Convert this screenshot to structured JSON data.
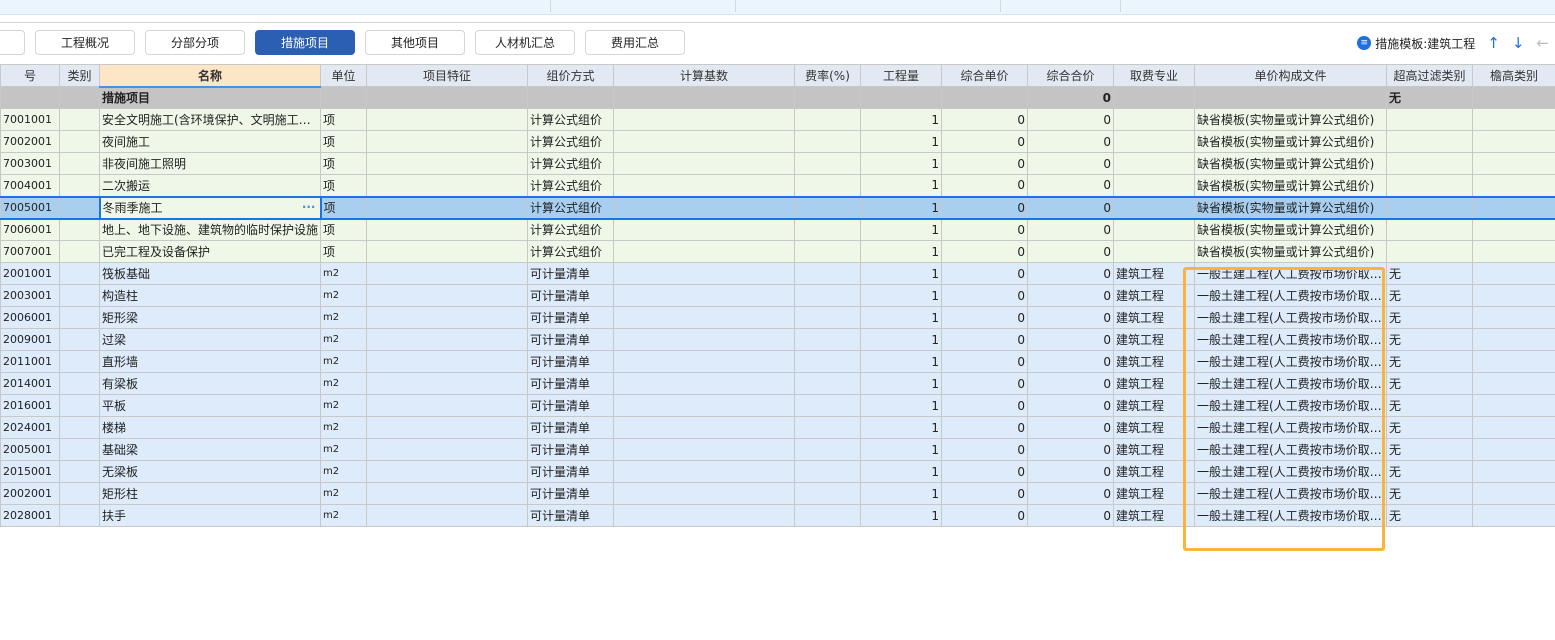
{
  "tabs": [
    {
      "label": ""
    },
    {
      "label": "工程概况"
    },
    {
      "label": "分部分项"
    },
    {
      "label": "措施项目",
      "active": true
    },
    {
      "label": "其他项目"
    },
    {
      "label": "人材机汇总"
    },
    {
      "label": "费用汇总"
    }
  ],
  "template": {
    "icon": "list-icon",
    "label": "措施模板:建筑工程",
    "up": "↑",
    "down": "↓",
    "back": "←"
  },
  "columns": [
    "号",
    "类别",
    "名称",
    "单位",
    "项目特征",
    "组价方式",
    "计算基数",
    "费率(%)",
    "工程量",
    "综合单价",
    "综合合价",
    "取费专业",
    "单价构成文件",
    "超高过滤类别",
    "檐高类别"
  ],
  "section": {
    "name": "措施项目",
    "total": "0",
    "filter": "无"
  },
  "rows": [
    {
      "code": "7001001",
      "name": "安全文明施工(含环境保护、文明施工…",
      "unit": "项",
      "method": "计算公式组价",
      "qty": "1",
      "price": "0",
      "total": "0",
      "spec": "",
      "file": "缺省模板(实物量或计算公式组价)",
      "filter": "",
      "type": "green"
    },
    {
      "code": "7002001",
      "name": "夜间施工",
      "unit": "项",
      "method": "计算公式组价",
      "qty": "1",
      "price": "0",
      "total": "0",
      "spec": "",
      "file": "缺省模板(实物量或计算公式组价)",
      "filter": "",
      "type": "green"
    },
    {
      "code": "7003001",
      "name": "非夜间施工照明",
      "unit": "项",
      "method": "计算公式组价",
      "qty": "1",
      "price": "0",
      "total": "0",
      "spec": "",
      "file": "缺省模板(实物量或计算公式组价)",
      "filter": "",
      "type": "green"
    },
    {
      "code": "7004001",
      "name": "二次搬运",
      "unit": "项",
      "method": "计算公式组价",
      "qty": "1",
      "price": "0",
      "total": "0",
      "spec": "",
      "file": "缺省模板(实物量或计算公式组价)",
      "filter": "",
      "type": "green"
    },
    {
      "code": "7005001",
      "name": "冬雨季施工",
      "unit": "项",
      "method": "计算公式组价",
      "qty": "1",
      "price": "0",
      "total": "0",
      "spec": "",
      "file": "缺省模板(实物量或计算公式组价)",
      "filter": "",
      "type": "sel"
    },
    {
      "code": "7006001",
      "name": "地上、地下设施、建筑物的临时保护设施",
      "unit": "项",
      "method": "计算公式组价",
      "qty": "1",
      "price": "0",
      "total": "0",
      "spec": "",
      "file": "缺省模板(实物量或计算公式组价)",
      "filter": "",
      "type": "green"
    },
    {
      "code": "7007001",
      "name": "已完工程及设备保护",
      "unit": "项",
      "method": "计算公式组价",
      "qty": "1",
      "price": "0",
      "total": "0",
      "spec": "",
      "file": "缺省模板(实物量或计算公式组价)",
      "filter": "",
      "type": "green"
    },
    {
      "code": "2001001",
      "name": "筏板基础",
      "unit": "m2",
      "method": "可计量清单",
      "qty": "1",
      "price": "0",
      "total": "0",
      "spec": "建筑工程",
      "file": "一般土建工程(人工费按市场价取…",
      "filter": "无",
      "type": "blue"
    },
    {
      "code": "2003001",
      "name": "构造柱",
      "unit": "m2",
      "method": "可计量清单",
      "qty": "1",
      "price": "0",
      "total": "0",
      "spec": "建筑工程",
      "file": "一般土建工程(人工费按市场价取…",
      "filter": "无",
      "type": "blue"
    },
    {
      "code": "2006001",
      "name": "矩形梁",
      "unit": "m2",
      "method": "可计量清单",
      "qty": "1",
      "price": "0",
      "total": "0",
      "spec": "建筑工程",
      "file": "一般土建工程(人工费按市场价取…",
      "filter": "无",
      "type": "blue"
    },
    {
      "code": "2009001",
      "name": "过梁",
      "unit": "m2",
      "method": "可计量清单",
      "qty": "1",
      "price": "0",
      "total": "0",
      "spec": "建筑工程",
      "file": "一般土建工程(人工费按市场价取…",
      "filter": "无",
      "type": "blue"
    },
    {
      "code": "2011001",
      "name": "直形墙",
      "unit": "m2",
      "method": "可计量清单",
      "qty": "1",
      "price": "0",
      "total": "0",
      "spec": "建筑工程",
      "file": "一般土建工程(人工费按市场价取…",
      "filter": "无",
      "type": "blue"
    },
    {
      "code": "2014001",
      "name": "有梁板",
      "unit": "m2",
      "method": "可计量清单",
      "qty": "1",
      "price": "0",
      "total": "0",
      "spec": "建筑工程",
      "file": "一般土建工程(人工费按市场价取…",
      "filter": "无",
      "type": "blue"
    },
    {
      "code": "2016001",
      "name": "平板",
      "unit": "m2",
      "method": "可计量清单",
      "qty": "1",
      "price": "0",
      "total": "0",
      "spec": "建筑工程",
      "file": "一般土建工程(人工费按市场价取…",
      "filter": "无",
      "type": "blue"
    },
    {
      "code": "2024001",
      "name": "楼梯",
      "unit": "m2",
      "method": "可计量清单",
      "qty": "1",
      "price": "0",
      "total": "0",
      "spec": "建筑工程",
      "file": "一般土建工程(人工费按市场价取…",
      "filter": "无",
      "type": "blue"
    },
    {
      "code": "2005001",
      "name": "基础梁",
      "unit": "m2",
      "method": "可计量清单",
      "qty": "1",
      "price": "0",
      "total": "0",
      "spec": "建筑工程",
      "file": "一般土建工程(人工费按市场价取…",
      "filter": "无",
      "type": "blue"
    },
    {
      "code": "2015001",
      "name": "无梁板",
      "unit": "m2",
      "method": "可计量清单",
      "qty": "1",
      "price": "0",
      "total": "0",
      "spec": "建筑工程",
      "file": "一般土建工程(人工费按市场价取…",
      "filter": "无",
      "type": "blue"
    },
    {
      "code": "2002001",
      "name": "矩形柱",
      "unit": "m2",
      "method": "可计量清单",
      "qty": "1",
      "price": "0",
      "total": "0",
      "spec": "建筑工程",
      "file": "一般土建工程(人工费按市场价取…",
      "filter": "无",
      "type": "blue"
    },
    {
      "code": "2028001",
      "name": "扶手",
      "unit": "m2",
      "method": "可计量清单",
      "qty": "1",
      "price": "0",
      "total": "0",
      "spec": "建筑工程",
      "file": "一般土建工程(人工费按市场价取…",
      "filter": "无",
      "type": "blue"
    }
  ],
  "colors": {
    "accent": "#2a5fb4",
    "highlight": "#f9b43c",
    "selection": "#a9cff0",
    "measure_row": "#eef7e8",
    "list_row": "#deebfb"
  }
}
